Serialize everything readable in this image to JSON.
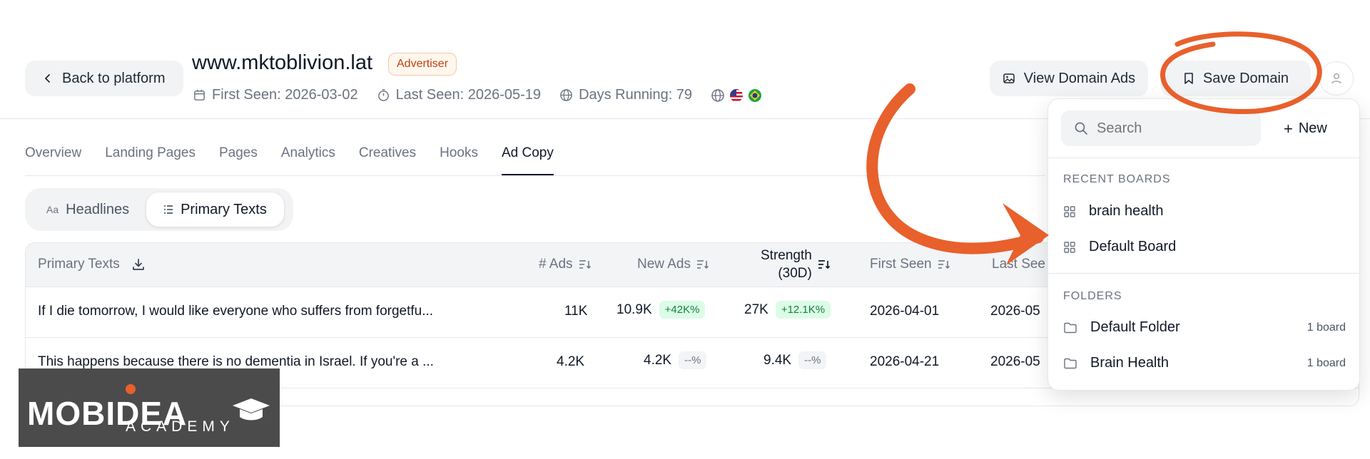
{
  "header": {
    "back_label": "Back to platform",
    "domain": "www.mktoblivion.lat",
    "badge": "Advertiser",
    "first_seen": "First Seen: 2026-03-02",
    "last_seen": "Last Seen: 2026-05-19",
    "days_running": "Days Running: 79",
    "view_ads_label": "View Domain Ads",
    "save_label": "Save Domain"
  },
  "tabs": [
    "Overview",
    "Landing Pages",
    "Pages",
    "Analytics",
    "Creatives",
    "Hooks",
    "Ad Copy"
  ],
  "active_tab": "Ad Copy",
  "segments": {
    "headlines": "Headlines",
    "primary": "Primary Texts"
  },
  "table": {
    "headers": {
      "primary": "Primary Texts",
      "ads": "# Ads",
      "new_ads": "New Ads",
      "strength_1": "Strength",
      "strength_2": "(30D)",
      "first_seen": "First Seen",
      "last_seen": "Last See"
    },
    "rows": [
      {
        "text": "If I die tomorrow, I would like everyone who suffers from forgetfu...",
        "ads": "11K",
        "new_ads": "10.9K",
        "new_ads_pct": "+42K%",
        "strength": "27K",
        "strength_pct": "+12.1K%",
        "first_seen": "2026-04-01",
        "last_seen": "2026-05"
      },
      {
        "text": "This happens because there is no dementia in Israel. If you're a ...",
        "ads": "4.2K",
        "new_ads": "4.2K",
        "new_ads_pct": "--%",
        "strength": "9.4K",
        "strength_pct": "--%",
        "first_seen": "2026-04-21",
        "last_seen": "2026-05"
      }
    ]
  },
  "dropdown": {
    "search_placeholder": "Search",
    "new_label": "New",
    "recent_title": "RECENT BOARDS",
    "recent": [
      "brain health",
      "Default Board"
    ],
    "folders_title": "FOLDERS",
    "folders": [
      {
        "name": "Default Folder",
        "count": "1 board"
      },
      {
        "name": "Brain Health",
        "count": "1 board"
      }
    ]
  },
  "logo": {
    "main": "MOBIDEA",
    "sub": "ACADEMY"
  },
  "colors": {
    "accent": "#e8602c",
    "positive": "#15803d"
  }
}
